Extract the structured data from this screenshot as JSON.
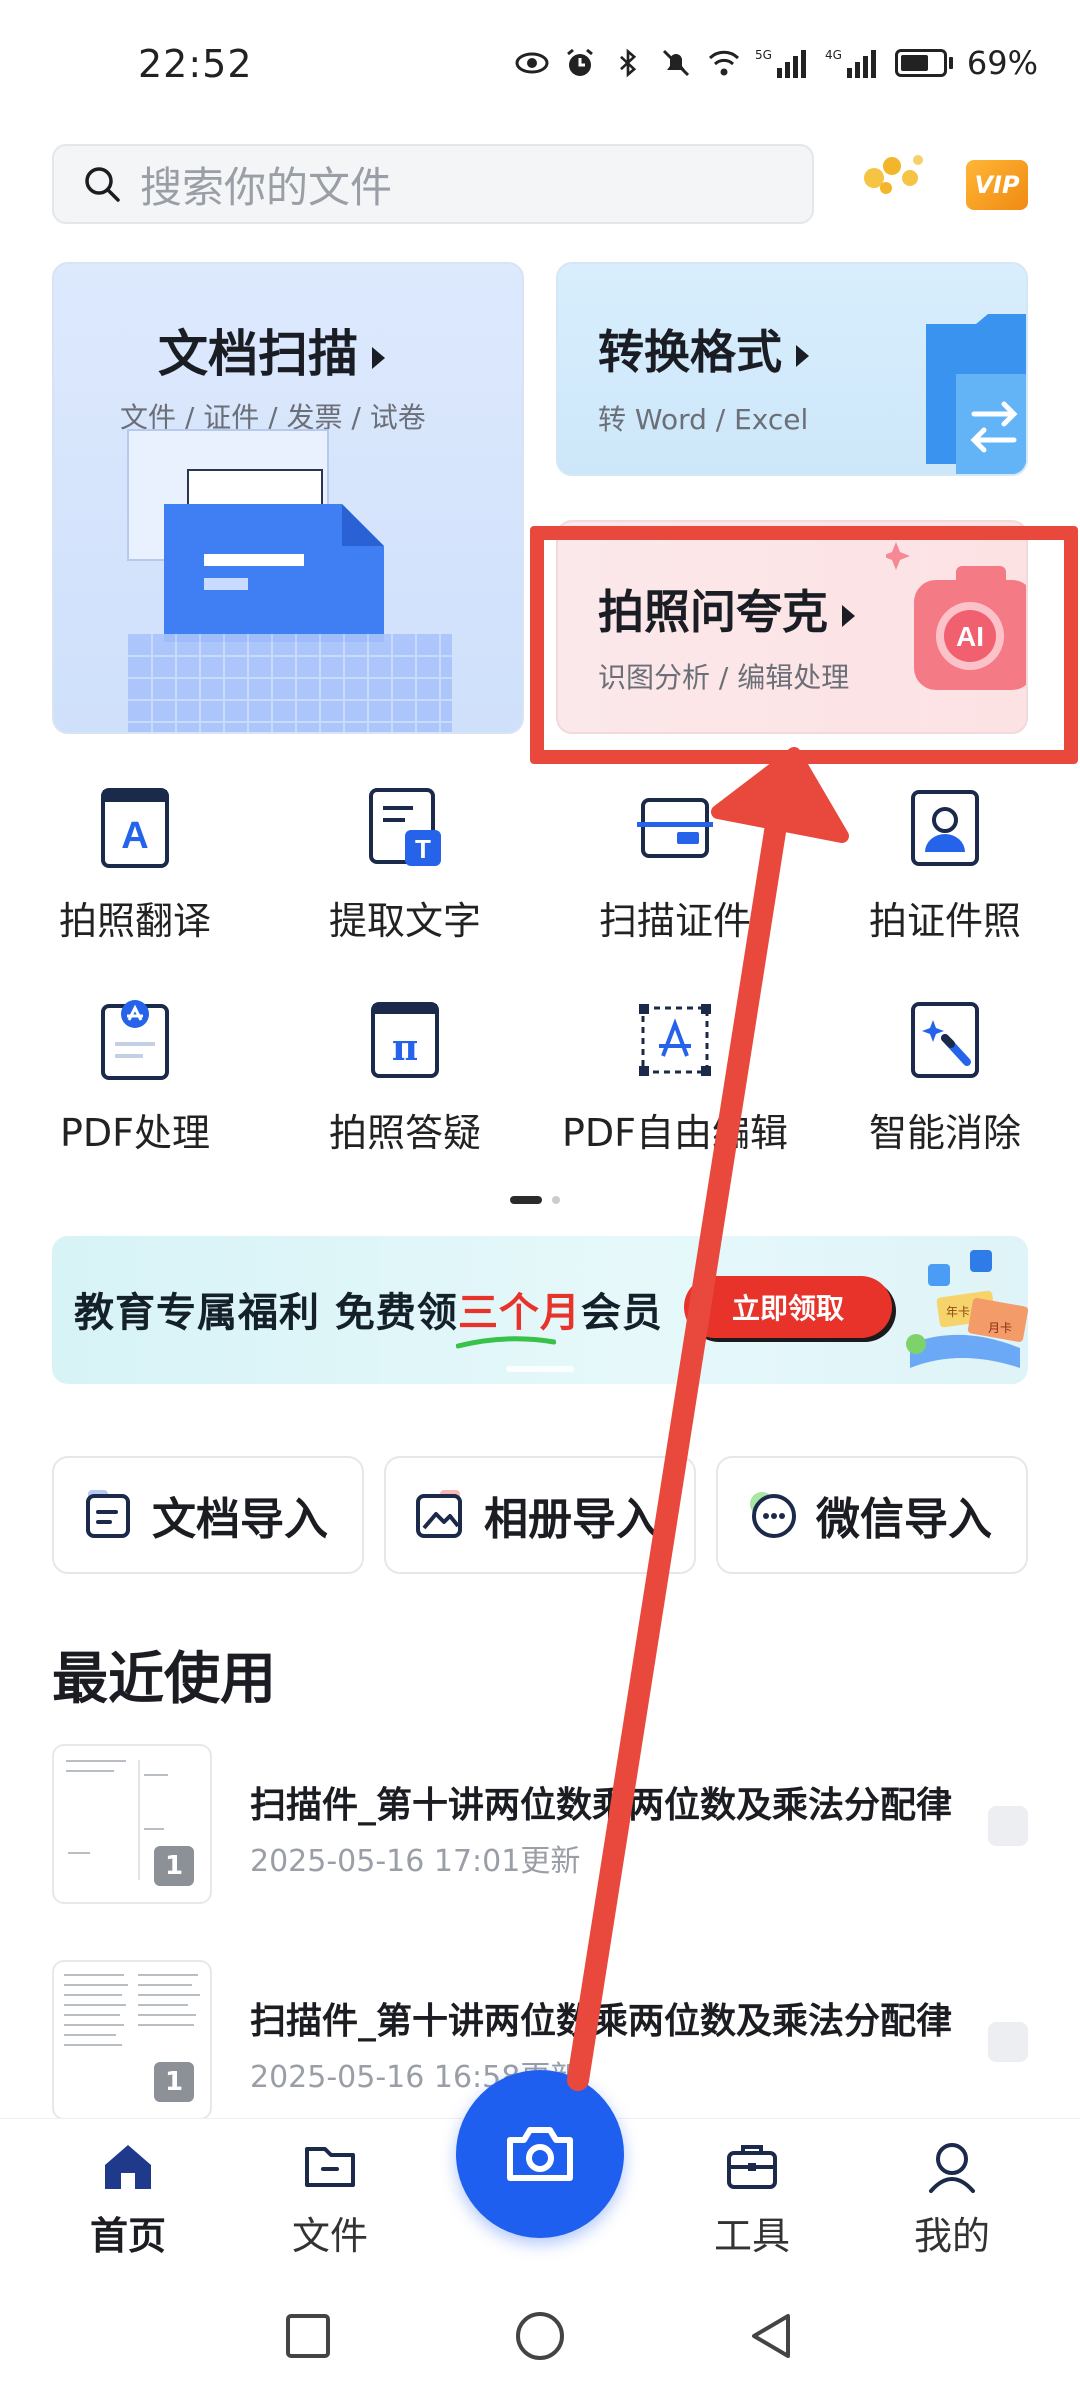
{
  "status_bar": {
    "time": "22:52",
    "network_5g": "5G",
    "network_4g": "4G",
    "battery": "69%"
  },
  "search": {
    "placeholder": "搜索你的文件"
  },
  "header": {
    "vip_label": "VIP"
  },
  "cards": {
    "scan": {
      "title": "文档扫描",
      "subtitle": "文件 / 证件 / 发票 / 试卷"
    },
    "convert": {
      "title": "转换格式",
      "subtitle": "转 Word / Excel"
    },
    "ask": {
      "title": "拍照问夸克",
      "subtitle": "识图分析 / 编辑处理",
      "badge": "AI"
    }
  },
  "tools": [
    {
      "label": "拍照翻译",
      "icon": "translate-icon"
    },
    {
      "label": "提取文字",
      "icon": "extract-text-icon"
    },
    {
      "label": "扫描证件",
      "icon": "id-card-icon"
    },
    {
      "label": "拍证件照",
      "icon": "id-photo-icon"
    },
    {
      "label": "PDF处理",
      "icon": "pdf-icon"
    },
    {
      "label": "拍照答疑",
      "icon": "pi-icon"
    },
    {
      "label": "PDF自由编辑",
      "icon": "pdf-edit-icon"
    },
    {
      "label": "智能消除",
      "icon": "magic-erase-icon"
    }
  ],
  "promo": {
    "text_before": "教育专属福利 免费领",
    "text_highlight": "三个月",
    "text_after": "会员",
    "button": "立即领取",
    "art_labels": [
      "年卡",
      "月卡"
    ]
  },
  "imports": [
    {
      "label": "文档导入"
    },
    {
      "label": "相册导入"
    },
    {
      "label": "微信导入"
    }
  ],
  "recent": {
    "title": "最近使用",
    "items": [
      {
        "name": "扫描件_第十讲两位数乘两位数及乘法分配律",
        "time": "2025-05-16 17:01更新",
        "pages": "1"
      },
      {
        "name": "扫描件_第十讲两位数乘两位数及乘法分配律",
        "time": "2025-05-16 16:58更新",
        "pages": "1"
      }
    ]
  },
  "bottom_nav": [
    {
      "label": "首页"
    },
    {
      "label": "文件"
    },
    {
      "label": "工具"
    },
    {
      "label": "我的"
    }
  ],
  "colors": {
    "accent": "#1f5ff0",
    "annotation": "#e8493c",
    "promo_red": "#e8332b"
  }
}
